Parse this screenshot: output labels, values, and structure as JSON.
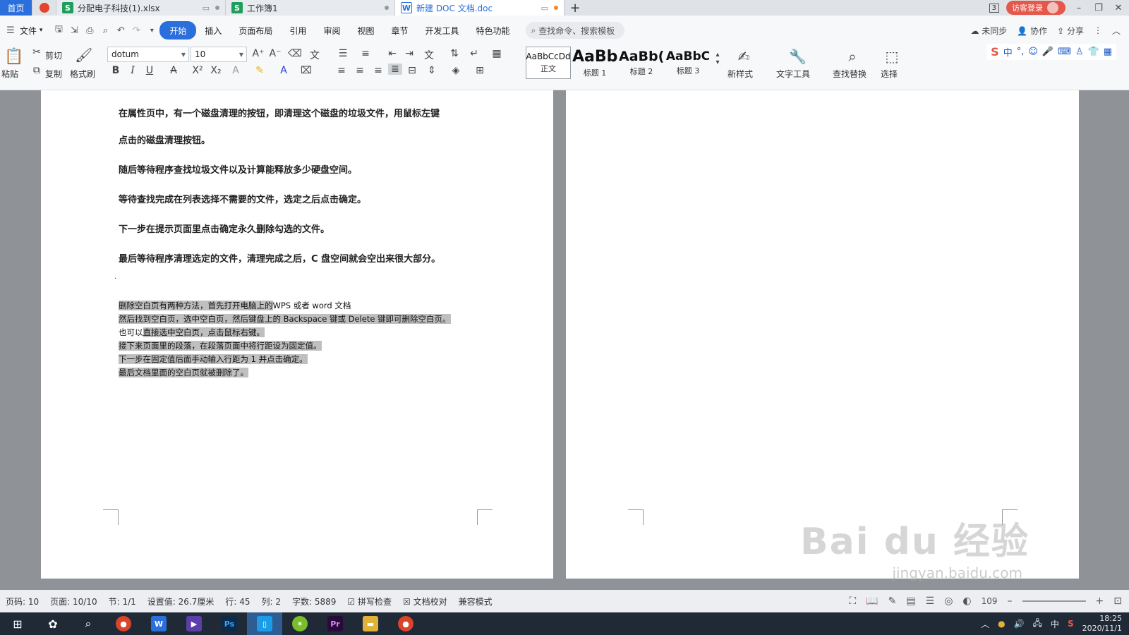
{
  "tabs": [
    {
      "label": "首页",
      "type": "home"
    },
    {
      "label": "",
      "type": "app-logo"
    },
    {
      "label": "分配电子科技(1).xlsx",
      "type": "sheet",
      "icon_letter": "S",
      "color": "#1e9e5a"
    },
    {
      "label": "工作簿1",
      "type": "sheet",
      "icon_letter": "S",
      "color": "#1e9e5a"
    },
    {
      "label": "新建 DOC 文档.doc",
      "type": "doc",
      "icon_letter": "W",
      "color": "#2a6fdb",
      "active": true
    }
  ],
  "titlebar": {
    "badge": "3",
    "login": "访客登录"
  },
  "menu": {
    "file": "文件",
    "items": [
      "开始",
      "插入",
      "页面布局",
      "引用",
      "审阅",
      "视图",
      "章节",
      "开发工具",
      "特色功能"
    ],
    "active": "开始",
    "search_placeholder": "查找命令、搜索模板",
    "right": {
      "sync": "未同步",
      "collab": "协作",
      "share": "分享"
    }
  },
  "ribbon": {
    "paste": "粘贴",
    "cut": "剪切",
    "copy": "复制",
    "format_painter": "格式刷",
    "font_name": "dotum",
    "font_size": "10",
    "styles": [
      {
        "sample": "AaBbCcDd",
        "label": "正文"
      },
      {
        "sample": "AaBb",
        "label": "标题 1"
      },
      {
        "sample": "AaBb(",
        "label": "标题 2"
      },
      {
        "sample": "AaBbC",
        "label": "标题 3"
      }
    ],
    "new_style": "新样式",
    "text_tools": "文字工具",
    "find_replace": "查找替换",
    "select": "选择",
    "ime": "中"
  },
  "document": {
    "paragraphs": [
      "在属性页中，有一个磁盘清理的按钮，即清理这个磁盘的垃圾文件，用鼠标左键",
      "点击的磁盘清理按钮。",
      "随后等待程序查找垃圾文件以及计算能释放多少硬盘空间。",
      "等待查找完成在列表选择不需要的文件，选定之后点击确定。",
      "下一步在提示页面里点击确定永久删除勾选的文件。",
      "最后等待程序清理选定的文件，清理完成之后，C 盘空间就会空出来很大部分。"
    ],
    "highlighted_lines": [
      {
        "hl": "删除空白页有两种方法，首先打开电脑上的",
        "rest": "WPS 或者 word 文档"
      },
      {
        "hl": "然后找到空白页，选中空白页，然后键盘上的 Backspace 键或 Delete 键即可删除空白页。",
        "rest": ""
      },
      {
        "pre": "也可以",
        "hl": "直接选中空白页，点击鼠标右键。",
        "rest": ""
      },
      {
        "hl": "接下来页面里的段落，在段落页面中将行距设为固定值。",
        "rest": ""
      },
      {
        "hl": "下一步在固定值后面手动输入行距为 1 并点击确定。",
        "rest": ""
      },
      {
        "hl": "最后文档里面的空白页就被删除了。",
        "rest": ""
      }
    ],
    "watermark": "Bai du 经验",
    "watermark_url": "jingyan.baidu.com"
  },
  "status": {
    "page_num": "页码: 10",
    "pages": "页面: 10/10",
    "section": "节: 1/1",
    "setting": "设置值: 26.7厘米",
    "row": "行: 45",
    "col": "列: 2",
    "word_count": "字数: 5889",
    "spell": "拼写检查",
    "proof": "文档校对",
    "compat": "兼容模式",
    "zoom": "109"
  },
  "taskbar": {
    "ime": "中",
    "time": "18:25",
    "date": "2020/11/1"
  }
}
